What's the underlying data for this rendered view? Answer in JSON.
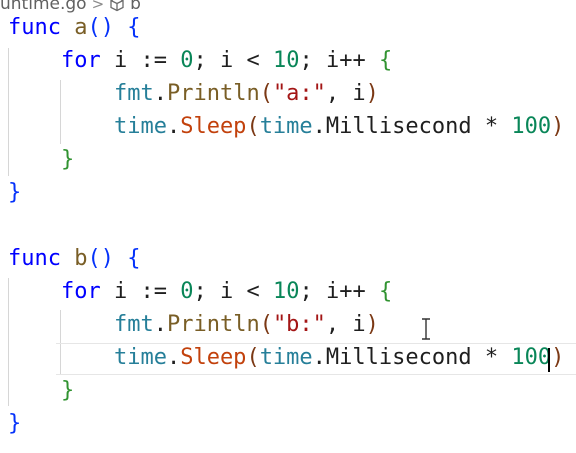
{
  "breadcrumb": {
    "file": "untime.go",
    "separator": ">",
    "symbol": "b",
    "symbol_icon": "cube-icon"
  },
  "editor": {
    "lines": [
      [
        [
          "kw",
          "func"
        ],
        [
          "id",
          " "
        ],
        [
          "fn",
          "a"
        ],
        [
          "br1",
          "()"
        ],
        [
          "id",
          " "
        ],
        [
          "br1",
          "{"
        ]
      ],
      [
        [
          "id",
          "    "
        ],
        [
          "kw",
          "for"
        ],
        [
          "id",
          " i "
        ],
        [
          "op",
          ":="
        ],
        [
          "id",
          " "
        ],
        [
          "num",
          "0"
        ],
        [
          "pun",
          "; "
        ],
        [
          "id",
          "i "
        ],
        [
          "op",
          "<"
        ],
        [
          "id",
          " "
        ],
        [
          "num",
          "10"
        ],
        [
          "pun",
          "; "
        ],
        [
          "id",
          "i"
        ],
        [
          "op",
          "++"
        ],
        [
          "id",
          " "
        ],
        [
          "br2",
          "{"
        ]
      ],
      [
        [
          "id",
          "        "
        ],
        [
          "pkg",
          "fmt"
        ],
        [
          "pun",
          "."
        ],
        [
          "fn",
          "Println"
        ],
        [
          "br3",
          "("
        ],
        [
          "str",
          "\"a:\""
        ],
        [
          "pun",
          ", "
        ],
        [
          "id",
          "i"
        ],
        [
          "br3",
          ")"
        ]
      ],
      [
        [
          "id",
          "        "
        ],
        [
          "pkg",
          "time"
        ],
        [
          "pun",
          "."
        ],
        [
          "sleep",
          "Sleep"
        ],
        [
          "br3",
          "("
        ],
        [
          "pkg",
          "time"
        ],
        [
          "pun",
          "."
        ],
        [
          "id",
          "Millisecond "
        ],
        [
          "op",
          "*"
        ],
        [
          "id",
          " "
        ],
        [
          "num",
          "100"
        ],
        [
          "br3",
          ")"
        ]
      ],
      [
        [
          "id",
          "    "
        ],
        [
          "br2",
          "}"
        ]
      ],
      [
        [
          "br1",
          "}"
        ]
      ],
      [],
      [
        [
          "kw",
          "func"
        ],
        [
          "id",
          " "
        ],
        [
          "fn",
          "b"
        ],
        [
          "br1",
          "()"
        ],
        [
          "id",
          " "
        ],
        [
          "br1",
          "{"
        ]
      ],
      [
        [
          "id",
          "    "
        ],
        [
          "kw",
          "for"
        ],
        [
          "id",
          " i "
        ],
        [
          "op",
          ":="
        ],
        [
          "id",
          " "
        ],
        [
          "num",
          "0"
        ],
        [
          "pun",
          "; "
        ],
        [
          "id",
          "i "
        ],
        [
          "op",
          "<"
        ],
        [
          "id",
          " "
        ],
        [
          "num",
          "10"
        ],
        [
          "pun",
          "; "
        ],
        [
          "id",
          "i"
        ],
        [
          "op",
          "++"
        ],
        [
          "id",
          " "
        ],
        [
          "br2",
          "{"
        ]
      ],
      [
        [
          "id",
          "        "
        ],
        [
          "pkg",
          "fmt"
        ],
        [
          "pun",
          "."
        ],
        [
          "fn",
          "Println"
        ],
        [
          "br3",
          "("
        ],
        [
          "str",
          "\"b:\""
        ],
        [
          "pun",
          ", "
        ],
        [
          "id",
          "i"
        ],
        [
          "br3",
          ")"
        ]
      ],
      [
        [
          "id",
          "        "
        ],
        [
          "pkg",
          "time"
        ],
        [
          "pun",
          "."
        ],
        [
          "sleep",
          "Sleep"
        ],
        [
          "br3",
          "("
        ],
        [
          "pkg",
          "time"
        ],
        [
          "pun",
          "."
        ],
        [
          "id",
          "Millisecond "
        ],
        [
          "op",
          "*"
        ],
        [
          "id",
          " "
        ],
        [
          "num",
          "100"
        ],
        [
          "br3",
          ")"
        ]
      ],
      [
        [
          "id",
          "    "
        ],
        [
          "br2",
          "}"
        ]
      ],
      [
        [
          "br1",
          "}"
        ]
      ]
    ],
    "current_line_index": 10,
    "cursor_icon": "text-cursor-icon"
  },
  "colors": {
    "keyword": "#0000ff",
    "function": "#795e26",
    "package": "#267f99",
    "number": "#098658",
    "string": "#a31515",
    "bracket_level1": "#0431fa",
    "bracket_level2": "#319331",
    "bracket_level3": "#7b3814"
  }
}
